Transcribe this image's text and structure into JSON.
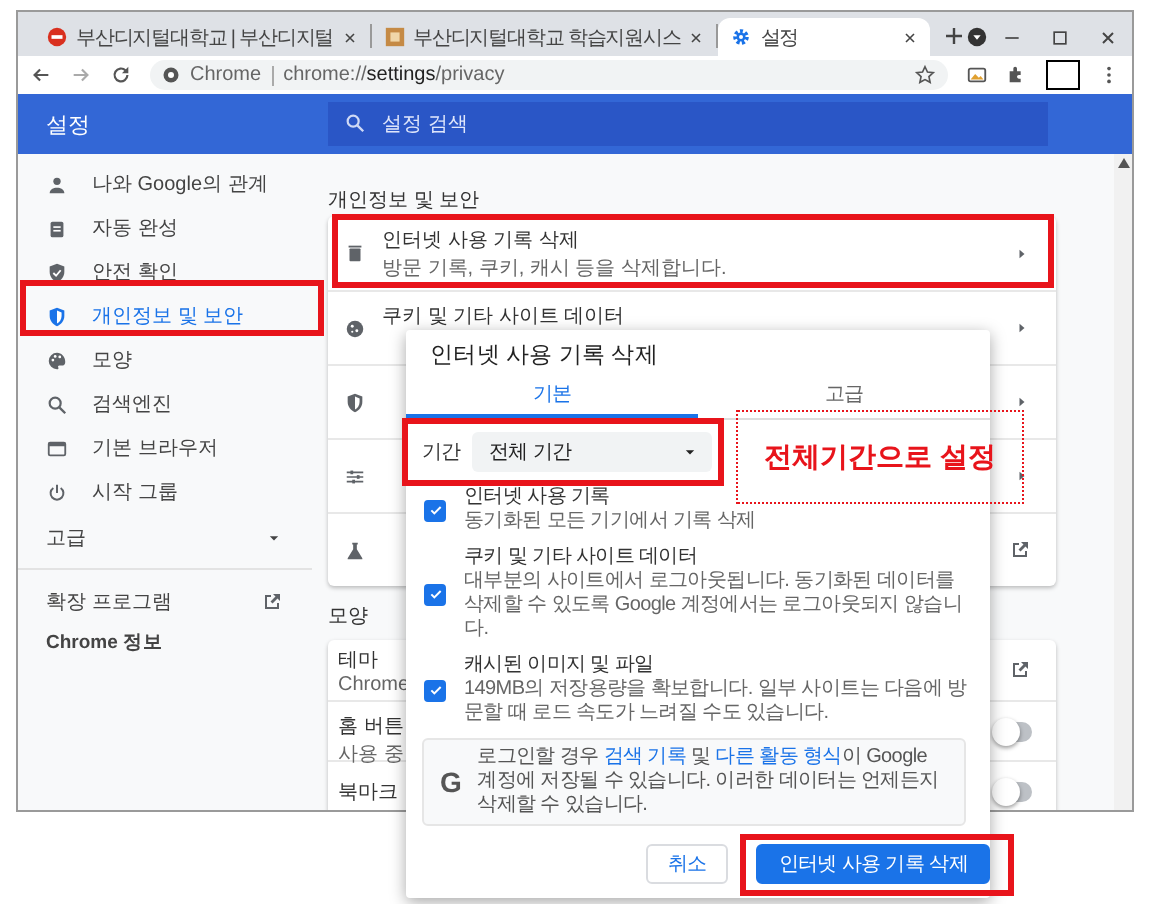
{
  "tabs": [
    {
      "title": "부산디지털대학교 | 부산디지털",
      "selected": false
    },
    {
      "title": "부산디지털대학교 학습지원시스",
      "selected": false
    },
    {
      "title": "설정",
      "selected": true
    }
  ],
  "address": {
    "site_label": "Chrome",
    "url": "chrome://**settings**/privacy"
  },
  "header": {
    "title": "설정",
    "search_placeholder": "설정 검색"
  },
  "sidebar": {
    "items": [
      {
        "label": "나와 Google의 관계",
        "selected": false
      },
      {
        "label": "자동 완성",
        "selected": false
      },
      {
        "label": "안전 확인",
        "selected": false
      },
      {
        "label": "개인정보 및 보안",
        "selected": true
      },
      {
        "label": "모양",
        "selected": false
      },
      {
        "label": "검색엔진",
        "selected": false
      },
      {
        "label": "기본 브라우저",
        "selected": false
      },
      {
        "label": "시작 그룹",
        "selected": false
      }
    ],
    "advanced": {
      "label": "고급",
      "expanded": false
    },
    "links": [
      {
        "label": "확장 프로그램",
        "kind": "external"
      },
      {
        "label": "Chrome 정보",
        "kind": "plain"
      }
    ]
  },
  "main": {
    "privacy_heading": "개인정보 및 보안",
    "privacy_rows": [
      {
        "kind": "arrow",
        "title": "인터넷 사용 기록 삭제",
        "subtitle": "방문 기록, 쿠키, 캐시 등을 삭제합니다."
      },
      {
        "kind": "arrow",
        "title": "쿠키 및 기타 사이트 데이터"
      },
      {
        "kind": "arrow"
      },
      {
        "kind": "arrow"
      },
      {
        "kind": "external"
      }
    ],
    "appearance_heading": "모양",
    "appearance_rows": [
      {
        "kind": "external",
        "title": "테마",
        "subtitle": "Chrome"
      },
      {
        "kind": "toggle",
        "title": "홈 버튼",
        "subtitle": "사용 중",
        "on": false
      },
      {
        "kind": "toggle",
        "title": "북마크",
        "on": false
      }
    ]
  },
  "dialog": {
    "title": "인터넷 사용 기록 삭제",
    "tabs": [
      {
        "label": "기본",
        "selected": true
      },
      {
        "label": "고급",
        "selected": false
      }
    ],
    "period_label": "기간",
    "period_value": "전체 기간",
    "items": [
      {
        "title": "인터넷 사용 기록",
        "description": "동기화된 모든 기기에서 기록 삭제",
        "checked": true
      },
      {
        "title": "쿠키 및 기타 사이트 데이터",
        "description": "대부분의 사이트에서 로그아웃됩니다. 동기화된 데이터를 삭제할 수 있도록 Google 계정에서는 로그아웃되지 않습니다.",
        "checked": true
      },
      {
        "title": "캐시된 이미지 및 파일",
        "description": "149MB의 저장용량을 확보합니다. 일부 사이트는 다음에 방문할 때 로드 속도가 느려질 수도 있습니다.",
        "checked": true
      }
    ],
    "notice_icon": "G",
    "notice_parts": [
      {
        "kind": "text",
        "text": "로그인할 경우 "
      },
      {
        "kind": "link",
        "text": "검색 기록"
      },
      {
        "kind": "text",
        "text": " 및 "
      },
      {
        "kind": "link",
        "text": "다른 활동 형식"
      },
      {
        "kind": "text",
        "text": "이 Google 계정에 저장될 수 있습니다. 이러한 데이터는 언제든지 삭제할 수 있습니다."
      }
    ],
    "buttons": [
      {
        "kind": "secondary",
        "label": "취소"
      },
      {
        "kind": "primary",
        "label": "인터넷 사용 기록 삭제"
      }
    ]
  },
  "annotation": {
    "label": "전체기간으로 설정"
  }
}
